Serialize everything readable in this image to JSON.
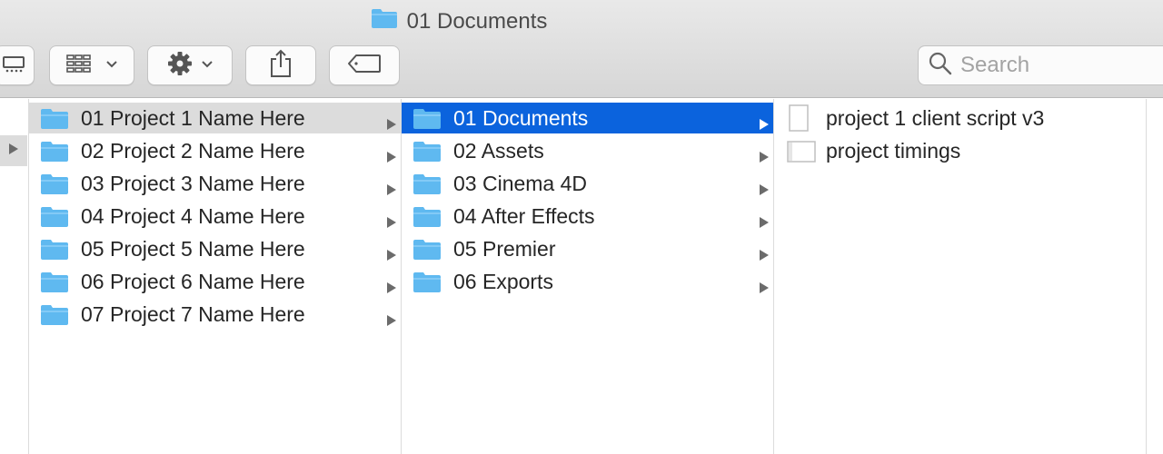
{
  "window": {
    "title": "01 Documents"
  },
  "toolbar": {
    "buttons": [
      "view-toggle-button",
      "group-by-button",
      "action-menu-button",
      "share-button",
      "tags-button"
    ]
  },
  "search": {
    "placeholder": "Search"
  },
  "columns": {
    "projects": [
      "01 Project 1 Name Here",
      "02 Project 2 Name Here",
      "03 Project 3 Name Here",
      "04 Project 4 Name Here",
      "05 Project 5 Name Here",
      "06 Project 6 Name Here",
      "07 Project 7 Name Here"
    ],
    "subfolders": [
      "01 Documents",
      "02 Assets",
      "03 Cinema 4D",
      "04 After Effects",
      "05 Premier",
      "06 Exports"
    ],
    "files": [
      "project 1 client script v3",
      "project timings"
    ]
  },
  "colors": {
    "selection": "#0b63dd",
    "inactive_selection": "#dcdcdc",
    "folder": "#5fb9f0"
  }
}
